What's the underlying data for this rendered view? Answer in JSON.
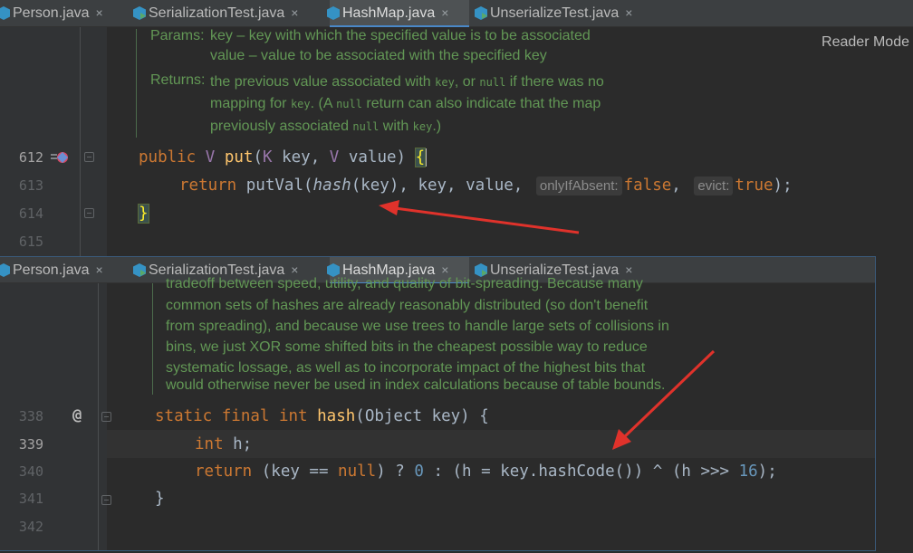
{
  "tabs": [
    {
      "label": "Person.java",
      "icon": "class-icon",
      "active": false
    },
    {
      "label": "SerializationTest.java",
      "icon": "class-runnable-icon",
      "active": false
    },
    {
      "label": "HashMap.java",
      "icon": "class-icon",
      "active": true
    },
    {
      "label": "UnserializeTest.java",
      "icon": "class-runnable-icon",
      "active": false
    }
  ],
  "close_glyph": "×",
  "reader_mode": "Reader Mode",
  "top": {
    "doc": {
      "params_label": "Params:",
      "param_1": "key – key with which the specified value is to be associated",
      "param_2": "value – value to be associated with the specified key",
      "returns_label": "Returns:",
      "ret_1a": "the previous value associated with ",
      "ret_1b": "key",
      "ret_1c": ", or ",
      "ret_1d": "null",
      "ret_1e": " if there was no",
      "ret_2a": "mapping for ",
      "ret_2b": "key",
      "ret_2c": ". (A ",
      "ret_2d": "null",
      "ret_2e": " return can also indicate that the map",
      "ret_3a": "previously associated ",
      "ret_3b": "null",
      "ret_3c": " with ",
      "ret_3d": "key",
      "ret_3e": ".)"
    },
    "line_numbers": [
      "612",
      "613",
      "614",
      "615"
    ],
    "l612": {
      "kw": "public",
      "t1": "V",
      "fn": "put",
      "p1": "(",
      "t2": "K",
      "a1": " key, ",
      "t3": "V",
      "a2": " value) ",
      "brace": "{"
    },
    "l613": {
      "kw": "return",
      "call": "putVal(",
      "fn": "hash",
      "args": "(key), key, value, ",
      "hint1": "onlyIfAbsent:",
      "v1": "false",
      "c1": ", ",
      "hint2": "evict:",
      "v2": "true",
      "end": ");"
    },
    "l614": {
      "brace": "}"
    }
  },
  "bottom": {
    "doc_lines": [
      "tradeoff between speed, utility, and quality of bit-spreading. Because many",
      "common sets of hashes are already reasonably distributed (so don't benefit",
      "from spreading), and because we use trees to handle large sets of collisions in",
      "bins, we just XOR some shifted bits in the cheapest possible way to reduce",
      "systematic lossage, as well as to incorporate impact of the highest bits that",
      "would otherwise never be used in index calculations because of table bounds."
    ],
    "line_numbers": [
      "338",
      "339",
      "340",
      "341",
      "342"
    ],
    "annotation": "@",
    "l338": {
      "kw1": "static final int",
      "fn": "hash",
      "rest": "(Object key) {"
    },
    "l339": {
      "kw": "int",
      "rest": " h;"
    },
    "l340": {
      "kw": "return",
      "a": " (key == ",
      "nul": "null",
      "b": ") ? ",
      "n0": "0",
      "c": " : (h = key.hashCode()) ^ (h >>> ",
      "n16": "16",
      "d": ");"
    },
    "l341": {
      "brace": "}"
    }
  },
  "colors": {
    "arrow": "#e0322b",
    "keyword": "#cc7832",
    "function": "#ffc66d",
    "doc": "#629755"
  }
}
